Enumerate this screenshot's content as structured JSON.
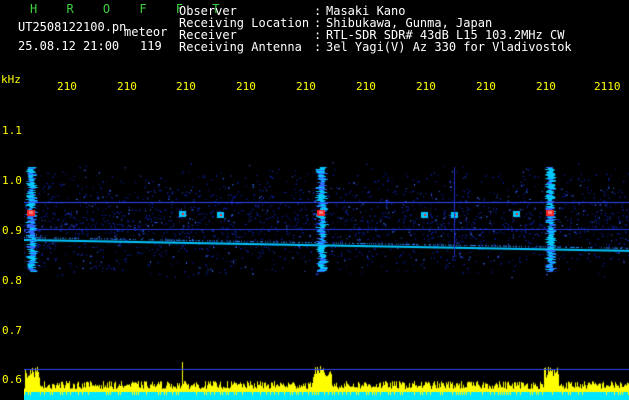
{
  "header": {
    "app_title": "H R O F F T",
    "filename": "UT2508122100.pn",
    "mode": "meteor",
    "datetime": "25.08.12 21:00",
    "count": "119",
    "fields": [
      {
        "label": "Observer",
        "sep": ":",
        "value": "Masaki Kano"
      },
      {
        "label": "Receiving Location",
        "sep": ":",
        "value": "Shibukawa, Gunma, Japan"
      },
      {
        "label": "Receiver",
        "sep": ":",
        "value": "RTL-SDR SDR# 43dB L15 103.2MHz CW"
      },
      {
        "label": "Receiving Antenna",
        "sep": ":",
        "value": "3el Yagi(V) Az 330 for Vladivostok"
      }
    ]
  },
  "axes": {
    "y_unit": "kHz",
    "y_ticks": [
      "1.1",
      "1.0",
      "0.9",
      "0.8",
      "0.7",
      "0.6"
    ],
    "x_ticks": [
      "210",
      "210",
      "210",
      "210",
      "210",
      "210",
      "210",
      "210",
      "210",
      "2110"
    ]
  },
  "colors": {
    "background": "#000000",
    "label_text": "#ffffff",
    "value_text": "#ffff00",
    "title": "#3ecf3e",
    "signal_strong": "#ff2020",
    "signal_mid": "#00c8ff",
    "noise": "#1a3cff",
    "activity_bars": "#ffff00",
    "baseline": "#00e5ff"
  }
}
